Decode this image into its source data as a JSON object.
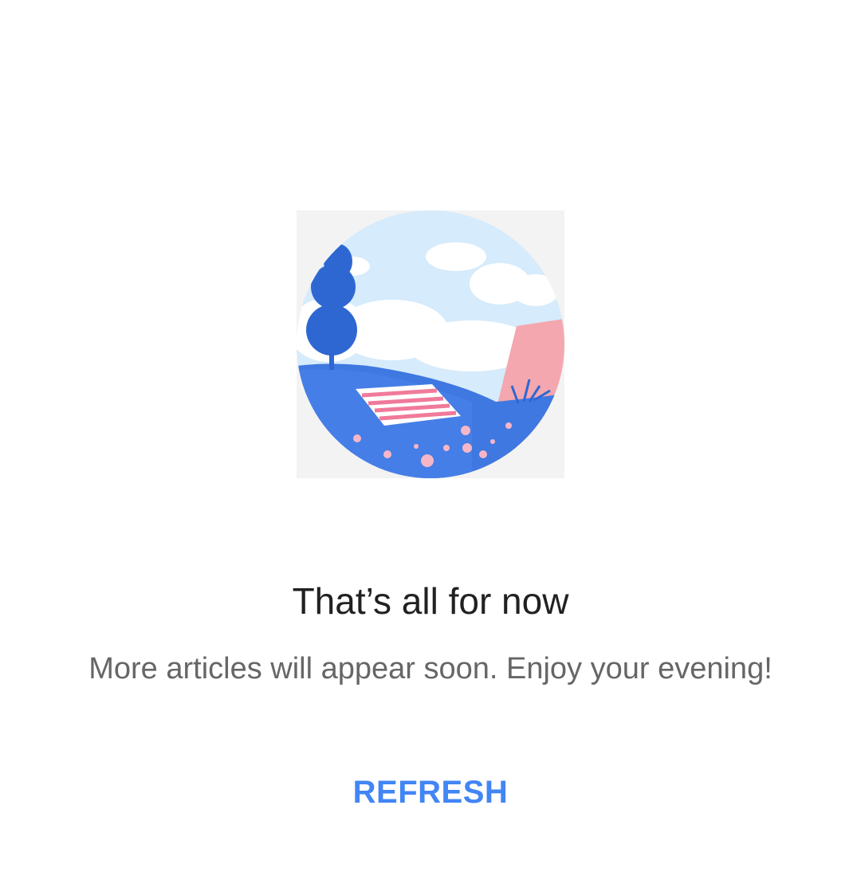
{
  "illustration": {
    "name": "picnic-hill-illustration",
    "colors": {
      "sky": "#d6ebfb",
      "cloud": "#ffffff",
      "tree": "#2f67d2",
      "hill": "#3f78e0",
      "hill_light": "#5a8ff0",
      "pink": "#f4a7ae",
      "blanket_stripe": "#f07a9a",
      "flower": "#f6b6c8"
    }
  },
  "message": {
    "title": "That’s all for now",
    "subtitle": "More articles will appear soon. Enjoy your evening!"
  },
  "actions": {
    "refresh_label": "REFRESH"
  },
  "theme": {
    "accent": "#4285f4",
    "title_color": "#212121",
    "subtitle_color": "#666666"
  }
}
